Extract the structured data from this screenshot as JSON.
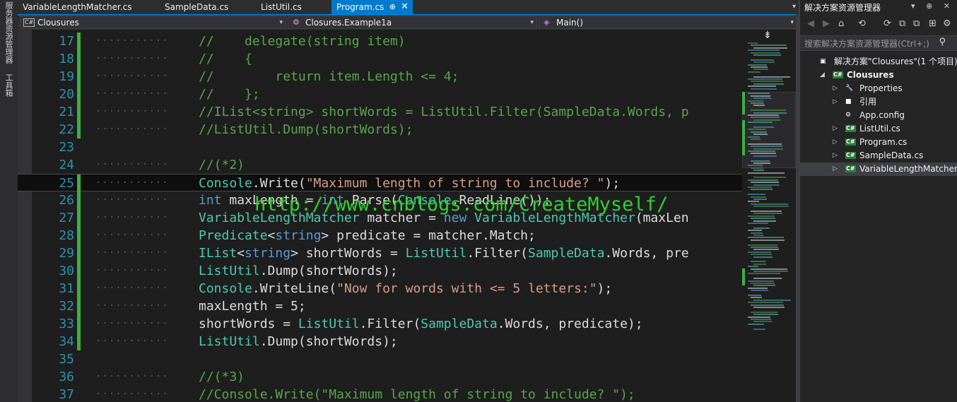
{
  "left_strip": {
    "items": [
      "服务器资源管理器",
      "工具箱"
    ]
  },
  "tabs": [
    {
      "label": "VariableLengthMatcher.cs",
      "active": false
    },
    {
      "label": "SampleData.cs",
      "active": false
    },
    {
      "label": "ListUtil.cs",
      "active": false
    },
    {
      "label": "Program.cs",
      "active": true,
      "pin": "⊕",
      "close": "✕"
    }
  ],
  "tab_dropdown": "▾",
  "navbar": {
    "project": "Clousures",
    "class": "Closures.Example1a",
    "member": "Main()",
    "project_icon": "C#"
  },
  "code_lines": [
    {
      "n": "17",
      "changed": true,
      "guide": true,
      "tokens": [
        [
          "cm",
          "//    delegate(string item)"
        ]
      ]
    },
    {
      "n": "18",
      "changed": true,
      "guide": true,
      "tokens": [
        [
          "cm",
          "//    {"
        ]
      ]
    },
    {
      "n": "19",
      "changed": true,
      "guide": true,
      "tokens": [
        [
          "cm",
          "//        return item.Length <= 4;"
        ]
      ]
    },
    {
      "n": "20",
      "changed": true,
      "guide": true,
      "tokens": [
        [
          "cm",
          "//    };"
        ]
      ]
    },
    {
      "n": "21",
      "changed": true,
      "guide": true,
      "tokens": [
        [
          "cm",
          "//IList<string> shortWords = ListUtil.Filter(SampleData.Words, p"
        ]
      ]
    },
    {
      "n": "22",
      "changed": true,
      "guide": true,
      "tokens": [
        [
          "cm",
          "//ListUtil.Dump(shortWords);"
        ]
      ]
    },
    {
      "n": "23",
      "changed": false,
      "guide": false,
      "tokens": []
    },
    {
      "n": "24",
      "changed": false,
      "guide": true,
      "tokens": [
        [
          "cm",
          "//(*2)"
        ]
      ]
    },
    {
      "n": "25",
      "changed": true,
      "guide": true,
      "current": true,
      "tokens": [
        [
          "ty",
          "Console"
        ],
        [
          "pl",
          ".Write("
        ],
        [
          "st",
          "\"Maximum length of string to include? \""
        ],
        [
          "pl",
          ");"
        ]
      ]
    },
    {
      "n": "26",
      "changed": true,
      "guide": true,
      "tokens": [
        [
          "kw",
          "int"
        ],
        [
          "pl",
          " maxLength = "
        ],
        [
          "kw",
          "int"
        ],
        [
          "pl",
          ".Parse("
        ],
        [
          "ty",
          "Console"
        ],
        [
          "pl",
          ".ReadLine());"
        ]
      ]
    },
    {
      "n": "27",
      "changed": true,
      "guide": true,
      "tokens": [
        [
          "ty",
          "VariableLengthMatcher"
        ],
        [
          "pl",
          " matcher = "
        ],
        [
          "kw",
          "new"
        ],
        [
          "pl",
          " "
        ],
        [
          "ty",
          "VariableLengthMatcher"
        ],
        [
          "pl",
          "(maxLen"
        ]
      ]
    },
    {
      "n": "28",
      "changed": true,
      "guide": true,
      "tokens": [
        [
          "ty",
          "Predicate"
        ],
        [
          "pl",
          "<"
        ],
        [
          "kw",
          "string"
        ],
        [
          "pl",
          "> predicate = matcher.Match;"
        ]
      ]
    },
    {
      "n": "29",
      "changed": true,
      "guide": true,
      "tokens": [
        [
          "ty",
          "IList"
        ],
        [
          "pl",
          "<"
        ],
        [
          "kw",
          "string"
        ],
        [
          "pl",
          "> shortWords = "
        ],
        [
          "ty",
          "ListUtil"
        ],
        [
          "pl",
          ".Filter("
        ],
        [
          "ty",
          "SampleData"
        ],
        [
          "pl",
          ".Words, pre"
        ]
      ]
    },
    {
      "n": "30",
      "changed": true,
      "guide": true,
      "tokens": [
        [
          "ty",
          "ListUtil"
        ],
        [
          "pl",
          ".Dump(shortWords);"
        ]
      ]
    },
    {
      "n": "31",
      "changed": true,
      "guide": true,
      "tokens": [
        [
          "ty",
          "Console"
        ],
        [
          "pl",
          ".WriteLine("
        ],
        [
          "st",
          "\"Now for words with <= 5 letters:\""
        ],
        [
          "pl",
          ");"
        ]
      ]
    },
    {
      "n": "32",
      "changed": true,
      "guide": true,
      "tokens": [
        [
          "pl",
          "maxLength = 5;"
        ]
      ]
    },
    {
      "n": "33",
      "changed": true,
      "guide": true,
      "tokens": [
        [
          "pl",
          "shortWords = "
        ],
        [
          "ty",
          "ListUtil"
        ],
        [
          "pl",
          ".Filter("
        ],
        [
          "ty",
          "SampleData"
        ],
        [
          "pl",
          ".Words, predicate);"
        ]
      ]
    },
    {
      "n": "34",
      "changed": true,
      "guide": true,
      "tokens": [
        [
          "ty",
          "ListUtil"
        ],
        [
          "pl",
          ".Dump(shortWords);"
        ]
      ]
    },
    {
      "n": "35",
      "changed": false,
      "guide": false,
      "tokens": []
    },
    {
      "n": "36",
      "changed": false,
      "guide": true,
      "tokens": [
        [
          "cm",
          "//(*3)"
        ]
      ]
    },
    {
      "n": "37",
      "changed": false,
      "guide": true,
      "tokens": [
        [
          "cm",
          "//Console.Write(\"Maximum length of string to include? \");"
        ]
      ]
    }
  ],
  "watermark": "http://www.cnblogs.com/CreateMyself/",
  "colors": {
    "comment": "#57a64a",
    "keyword": "#569cd6",
    "type": "#4ec9b0",
    "string": "#d69d85",
    "plain": "#dcdcdc",
    "line_number": "#2b91af",
    "change_bar": "#3cb043",
    "accent": "#007acc"
  },
  "minimap": {
    "split_icon": "⇟"
  },
  "solution_explorer": {
    "title": "解决方案资源管理器",
    "title_buttons": "▾ ⊕ ✕",
    "toolbar_icons": [
      "◀",
      "▶",
      "⌂",
      "⟲",
      "⟳",
      "⧉",
      "⧉",
      "⊞",
      "⚙"
    ],
    "search_placeholder": "搜索解决方案资源管理器(Ctrl+;)",
    "search_icon": "⚲",
    "tree": [
      {
        "label": "解决方案\"Clousures\"(1 个项目)",
        "depth": 0,
        "arrow": "",
        "icon": "▣",
        "bold": false
      },
      {
        "label": "Clousures",
        "depth": 1,
        "arrow": "◢",
        "icon": "C#",
        "bold": true
      },
      {
        "label": "Properties",
        "depth": 2,
        "arrow": "▷",
        "icon": "🔧",
        "bold": false
      },
      {
        "label": "引用",
        "depth": 2,
        "arrow": "▷",
        "icon": "■",
        "bold": false
      },
      {
        "label": "App.config",
        "depth": 2,
        "arrow": "",
        "icon": "⚙",
        "bold": false
      },
      {
        "label": "ListUtil.cs",
        "depth": 2,
        "arrow": "▷",
        "icon": "C#",
        "bold": false
      },
      {
        "label": "Program.cs",
        "depth": 2,
        "arrow": "▷",
        "icon": "C#",
        "bold": false
      },
      {
        "label": "SampleData.cs",
        "depth": 2,
        "arrow": "▷",
        "icon": "C#",
        "bold": false
      },
      {
        "label": "VariableLengthMatcher.cs",
        "depth": 2,
        "arrow": "▷",
        "icon": "C#",
        "bold": false,
        "selected": true
      }
    ]
  }
}
